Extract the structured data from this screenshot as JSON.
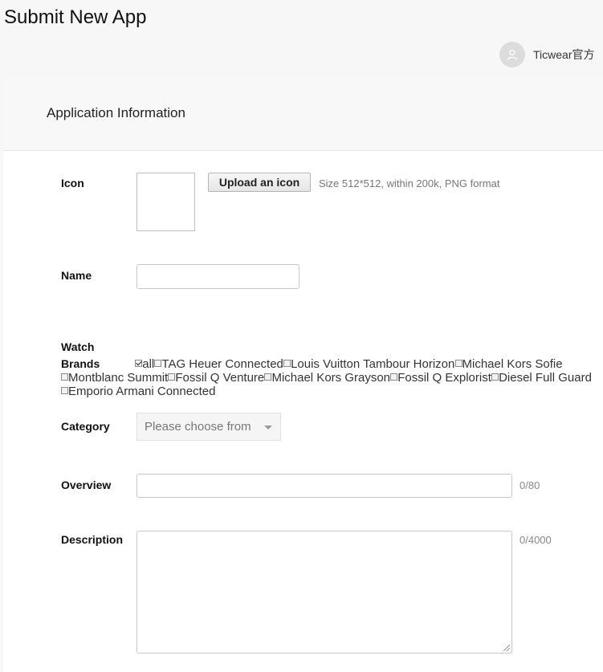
{
  "page": {
    "title": "Submit New App"
  },
  "user": {
    "name": "Ticwear官方",
    "avatar_icon": "user-icon"
  },
  "section": {
    "title": "Application Information"
  },
  "icon_field": {
    "label": "Icon",
    "upload_label": "Upload an icon",
    "hint": "Size 512*512, within 200k, PNG format"
  },
  "name_field": {
    "label": "Name",
    "value": ""
  },
  "brands": {
    "label_line1": "Watch",
    "label_line2": "Brands",
    "options": [
      {
        "label": "all",
        "checked": true
      },
      {
        "label": "TAG Heuer Connected",
        "checked": false
      },
      {
        "label": "Louis Vuitton Tambour Horizon",
        "checked": false
      },
      {
        "label": "Michael Kors Sofie",
        "checked": false
      },
      {
        "label": "Montblanc Summit",
        "checked": false
      },
      {
        "label": "Fossil Q Venture",
        "checked": false
      },
      {
        "label": "Michael Kors Grayson",
        "checked": false
      },
      {
        "label": "Fossil Q Explorist",
        "checked": false
      },
      {
        "label": "Diesel Full Guard",
        "checked": false
      },
      {
        "label": "Emporio Armani Connected",
        "checked": false
      }
    ]
  },
  "category": {
    "label": "Category",
    "placeholder": "Please choose from"
  },
  "overview": {
    "label": "Overview",
    "value": "",
    "counter": "0/80"
  },
  "description": {
    "label": "Description",
    "value": "",
    "counter": "0/4000"
  }
}
